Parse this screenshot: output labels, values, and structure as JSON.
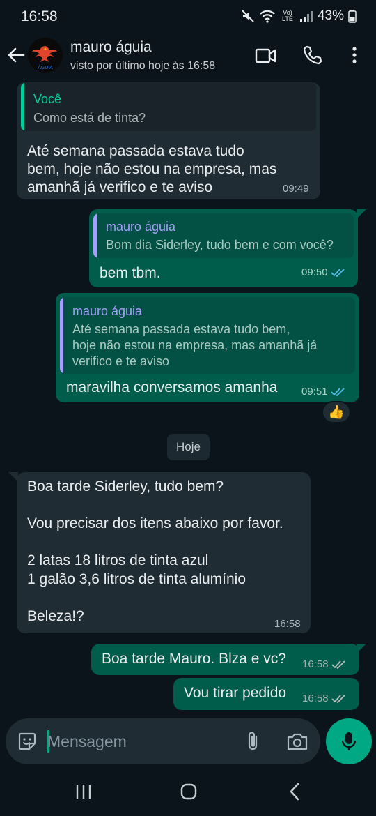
{
  "status_bar": {
    "time": "16:58",
    "network": "Vo) LTE",
    "battery": "43%"
  },
  "header": {
    "contact_name": "mauro águia",
    "last_seen": "visto por último hoje às 16:58",
    "avatar_text": "ÁGUIA",
    "icons": [
      "back-arrow-icon",
      "video-call-icon",
      "phone-icon",
      "more-vert-icon"
    ]
  },
  "messages": [
    {
      "direction": "in",
      "quote_author": "Você",
      "quote_text": "Como está  de tinta?",
      "text": "Até semana passada estava tudo\nbem, hoje não estou na empresa, mas\namanhã já verifico e te aviso",
      "time": "09:49"
    },
    {
      "direction": "out",
      "quote_author": "mauro águia",
      "quote_text": "Bom dia Siderley, tudo bem e com você?",
      "text": "bem tbm.",
      "time": "09:50",
      "status": "read"
    },
    {
      "direction": "out",
      "quote_author": "mauro águia",
      "quote_text": "Até semana passada estava tudo bem,\nhoje não estou na empresa, mas amanhã já\nverifico e te aviso",
      "text": "maravilha conversamos amanha",
      "time": "09:51",
      "status": "read",
      "reaction": "👍"
    },
    {
      "direction": "in",
      "text": "Boa tarde Siderley, tudo bem?\n\nVou precisar dos itens abaixo por favor.\n\n2 latas 18 litros de tinta azul\n1 galão 3,6 litros de tinta alumínio\n\nBeleza!?",
      "time": "16:58"
    },
    {
      "direction": "out",
      "text": "Boa tarde Mauro. Blza e vc?",
      "time": "16:58",
      "status": "delivered"
    },
    {
      "direction": "out",
      "text": "Vou tirar pedido",
      "time": "16:58",
      "status": "delivered"
    }
  ],
  "date_divider": "Hoje",
  "composer": {
    "placeholder": "Mensagem",
    "icons": [
      "sticker-icon",
      "attach-icon",
      "camera-icon",
      "mic-icon"
    ]
  },
  "colors": {
    "background": "#0b141a",
    "incoming_bubble": "#202c33",
    "outgoing_bubble": "#005c4b",
    "accent": "#00a884",
    "read_tick": "#53bdeb",
    "quote_you": "#06cf9c",
    "quote_contact": "#a5a0f9"
  }
}
